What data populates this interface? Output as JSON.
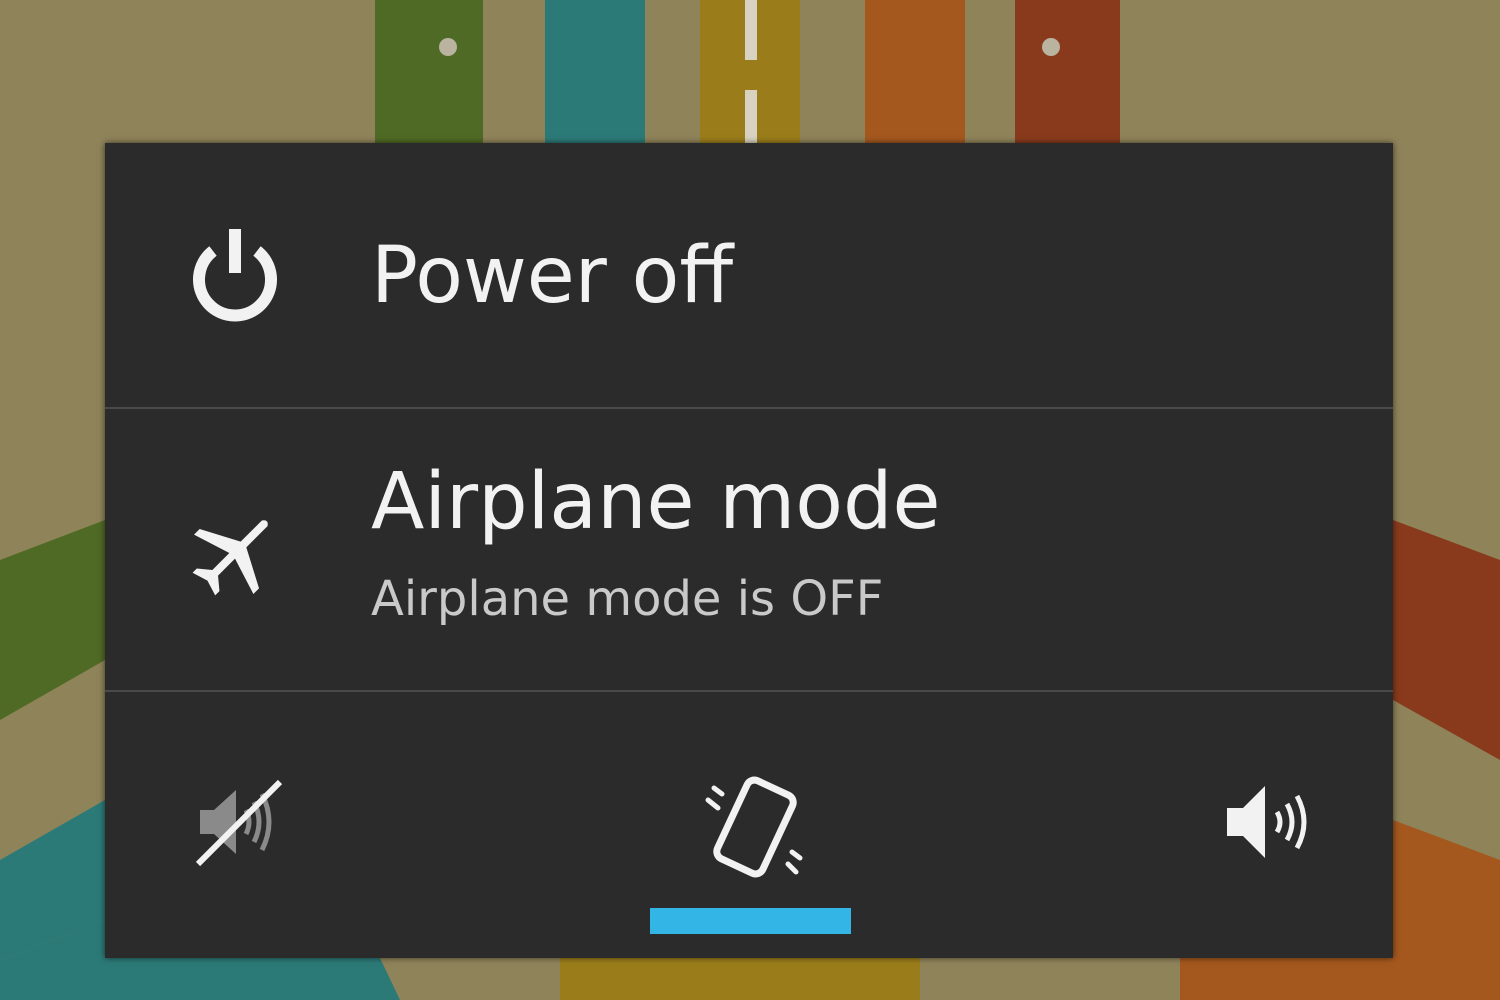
{
  "dialog": {
    "power_off": {
      "label": "Power off",
      "icon": "power-icon"
    },
    "airplane_mode": {
      "label": "Airplane mode",
      "status": "Airplane mode is OFF",
      "icon": "airplane-icon"
    },
    "ringer_modes": [
      {
        "mode": "silent",
        "icon": "mute-speaker-icon",
        "selected": false
      },
      {
        "mode": "vibrate",
        "icon": "vibrate-phone-icon",
        "selected": true
      },
      {
        "mode": "sound",
        "icon": "speaker-volume-icon",
        "selected": false
      }
    ]
  },
  "colors": {
    "dialog_bg": "#2b2b2b",
    "divider": "#4a4a4a",
    "text_primary": "#f2f2f2",
    "text_secondary": "#c9c9c9",
    "accent": "#33b5e5",
    "disabled_icon": "#8a8a8a"
  }
}
